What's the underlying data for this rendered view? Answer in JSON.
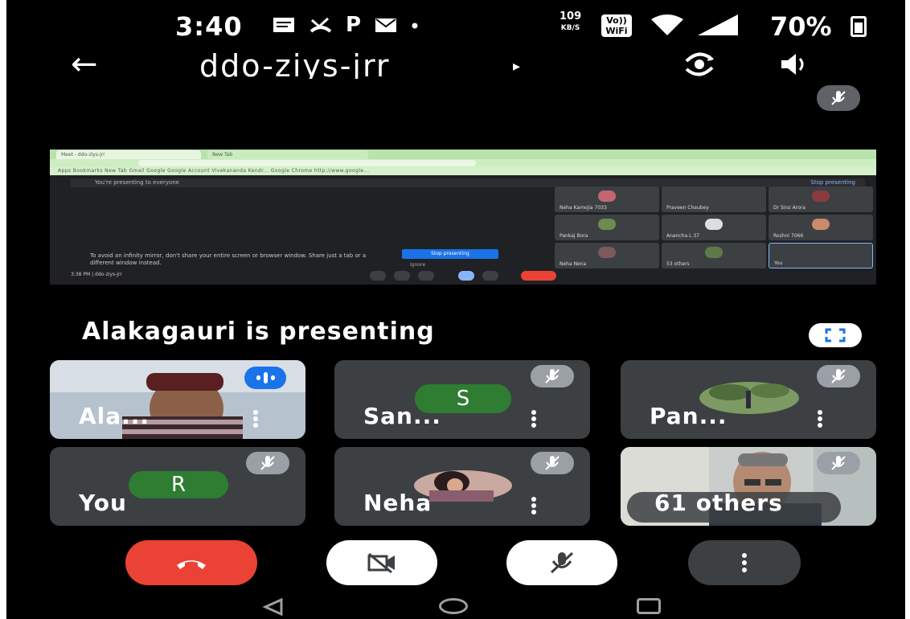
{
  "status_bar": {
    "time": "3:40",
    "icons": [
      "message-icon",
      "call-missed-icon",
      "p-icon",
      "mail-icon",
      "dot-icon"
    ],
    "p_glyph": "P",
    "net_speed_value": "109",
    "net_speed_unit": "KB/S",
    "volte_top": "Vo))",
    "volte_bottom": "WiFi",
    "battery_percent": "70%"
  },
  "top_bar": {
    "meeting_code": "ddo-ziys-jrr",
    "caret": "▸",
    "back_glyph": "←"
  },
  "presentation": {
    "label": "Alakagauri is presenting",
    "muted": true,
    "shared_screen": {
      "tabs": [
        "Meet - ddo-ziys-jrr",
        "New Tab"
      ],
      "bookmarks": "Apps   Bookmarks   New Tab   Gmail   Google   Google Account   Vivekananda Kendr...   Google   Chrome   http://www.google...",
      "banner_text": "You're presenting to everyone",
      "banner_stop": "Stop presenting",
      "notice": "To avoid an infinity mirror, don't share your entire screen or browser window. Share just a tab or a different window instead.",
      "stop_button": "Stop presenting",
      "ignore_link": "Ignore",
      "footer_time": "3:38 PM  |  ddo-ziys-jrr",
      "mini_participants": [
        "Neha Kamojia 7033",
        "Praveen Chaubey",
        "Dr Sirsi Arora",
        "Pankaj Bora",
        "Anancha L 37",
        "Roshni 7066",
        "Neha Nena",
        "53 others",
        "You"
      ]
    }
  },
  "participants": [
    {
      "name": "Ala...",
      "speaking": true,
      "has_video": true
    },
    {
      "name": "San...",
      "initial": "S",
      "muted": true,
      "avatar_color": "#2e7d32"
    },
    {
      "name": "Pan...",
      "muted": true,
      "has_photo": true
    },
    {
      "name": "You",
      "initial": "R",
      "muted": true,
      "avatar_color": "#2e7d32"
    },
    {
      "name": "Neha",
      "muted": true,
      "has_photo": true
    },
    {
      "name": "61 others",
      "muted": true,
      "has_video": true
    }
  ],
  "controls": {
    "end_call_color": "#ea4335",
    "camera_off": true,
    "mic_off": true
  },
  "colors": {
    "background": "#000000",
    "tile": "#3c4043",
    "accent_blue": "#1a73e8",
    "avatar_green": "#2e7d32",
    "end_call_red": "#ea4335"
  }
}
